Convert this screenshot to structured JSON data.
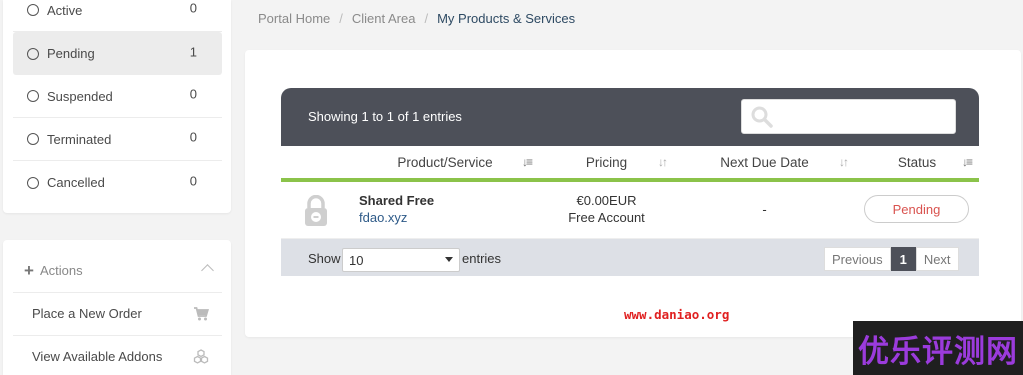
{
  "sidebar": {
    "statuses": [
      {
        "label": "Active",
        "count": "0"
      },
      {
        "label": "Pending",
        "count": "1"
      },
      {
        "label": "Suspended",
        "count": "0"
      },
      {
        "label": "Terminated",
        "count": "0"
      },
      {
        "label": "Cancelled",
        "count": "0"
      }
    ],
    "actions": {
      "title": "Actions",
      "items": [
        {
          "label": "Place a New Order",
          "icon": "cart-icon"
        },
        {
          "label": "View Available Addons",
          "icon": "cubes-icon"
        }
      ]
    }
  },
  "breadcrumb": [
    "Portal Home",
    "Client Area",
    "My Products & Services"
  ],
  "table": {
    "showing": "Showing 1 to 1 of 1 entries",
    "search": {
      "value": ""
    },
    "columns": [
      "Product/Service",
      "Pricing",
      "Next Due Date",
      "Status"
    ],
    "rows": [
      {
        "product": "Shared Free",
        "domain": "fdao.xyz",
        "price": "€0.00EUR",
        "cycle": "Free Account",
        "due": "-",
        "status": "Pending",
        "icon": "lock-icon"
      }
    ],
    "footer": {
      "show_label": "Show",
      "page_size": "10",
      "entries_label": "entries",
      "prev": "Previous",
      "page": "1",
      "next": "Next"
    }
  },
  "site_url": "www.daniao.org",
  "watermark": "优乐评测网",
  "colors": {
    "header_dark": "#4d5059",
    "accent_green": "#8bc34a",
    "status_pending": "#d9534f",
    "link_blue": "#2e5a88",
    "watermark_purple": "#9b3bdc"
  }
}
